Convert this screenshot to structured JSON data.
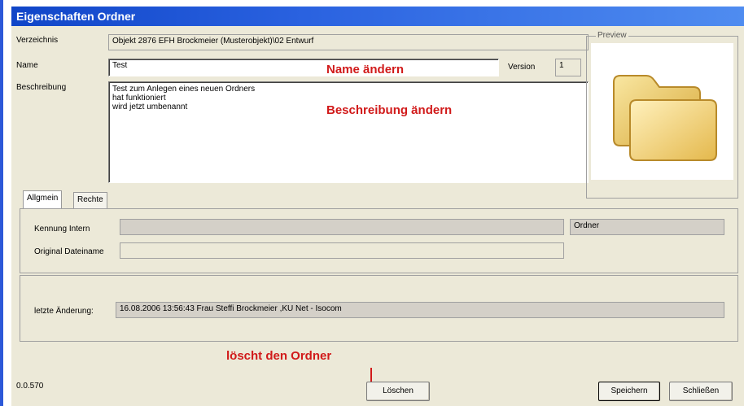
{
  "window": {
    "title": "Eigenschaften Ordner"
  },
  "form": {
    "verzeichnis_label": "Verzeichnis",
    "verzeichnis_value": "Objekt 2876 EFH Brockmeier (Musterobjekt)\\02 Entwurf",
    "name_label": "Name",
    "name_value": "Test",
    "version_label": "Version",
    "version_value": "1",
    "beschreibung_label": "Beschreibung",
    "beschreibung_lines": [
      "Test zum Anlegen eines neuen Ordners",
      "hat funktioniert",
      "wird jetzt umbenannt"
    ]
  },
  "preview": {
    "label": "Preview",
    "icon": "folder-icon"
  },
  "tabs": [
    {
      "label": "Allgmein"
    },
    {
      "label": "Rechte"
    }
  ],
  "allgemein": {
    "kennung_label": "Kennung Intern",
    "kennung_value": "",
    "type_value": "Ordner",
    "original_label": "Original Dateiname",
    "original_value": ""
  },
  "change": {
    "label": "letzte Änderung:",
    "value": "16.08.2006 13:56:43 Frau Steffi Brockmeier ,KU Net - Isocom"
  },
  "annotations": {
    "name": "Name ändern",
    "beschreibung": "Beschreibung ändern",
    "loeschen": "löscht den Ordner"
  },
  "footer": {
    "version": "0.0.570",
    "delete_label": "Löschen",
    "save_label": "Speichern",
    "close_label": "Schließen"
  },
  "colors": {
    "titlebar": "#2a62e0",
    "annotation": "#d11a1a",
    "dialog_bg": "#ece9d8"
  }
}
